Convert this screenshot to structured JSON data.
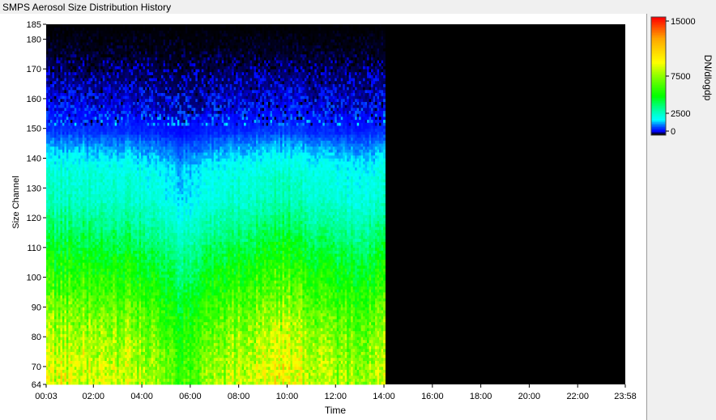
{
  "window": {
    "title": "SMPS Aerosol Size Distribution History"
  },
  "chart_data": {
    "type": "heatmap",
    "title": "SMPS Aerosol Size Distribution History",
    "xlabel": "Time",
    "ylabel": "Size Channel",
    "x_ticks": [
      "00:03",
      "02:00",
      "04:00",
      "06:00",
      "08:00",
      "10:00",
      "12:00",
      "14:00",
      "16:00",
      "18:00",
      "20:00",
      "22:00",
      "23:58"
    ],
    "y_ticks": [
      64,
      70,
      80,
      90,
      100,
      110,
      120,
      130,
      140,
      150,
      160,
      170,
      180,
      185
    ],
    "ylim": [
      64,
      185
    ],
    "data_range": [
      "00:03",
      "14:00"
    ],
    "colorbar": {
      "label": "DN/dlogdp",
      "ticks": [
        "15000",
        "7500",
        "2500",
        "0"
      ],
      "min": 0,
      "max": 15000,
      "colors": [
        "#000000",
        "#0000ff",
        "#00ffff",
        "#00ff00",
        "#ffff00",
        "#ffa500",
        "#ff0000"
      ]
    },
    "profile_by_channel": [
      {
        "channel": 66,
        "level": 6500
      },
      {
        "channel": 75,
        "level": 6000
      },
      {
        "channel": 85,
        "level": 5000
      },
      {
        "channel": 95,
        "level": 3800
      },
      {
        "channel": 105,
        "level": 2800
      },
      {
        "channel": 115,
        "level": 1800
      },
      {
        "channel": 125,
        "level": 1100
      },
      {
        "channel": 135,
        "level": 900
      },
      {
        "channel": 142,
        "level": 500
      },
      {
        "channel": 148,
        "level": 200
      },
      {
        "channel": 155,
        "level": 80
      },
      {
        "channel": 165,
        "level": 40
      },
      {
        "channel": 175,
        "level": 10
      },
      {
        "channel": 185,
        "level": 0
      }
    ],
    "profile_by_time": [
      {
        "time": "00:03",
        "level": 1.0
      },
      {
        "time": "02:00",
        "level": 1.0
      },
      {
        "time": "04:00",
        "level": 0.9
      },
      {
        "time": "05:30",
        "level": 0.55
      },
      {
        "time": "06:00",
        "level": 0.6
      },
      {
        "time": "08:00",
        "level": 0.95
      },
      {
        "time": "10:00",
        "level": 1.2
      },
      {
        "time": "11:00",
        "level": 0.95
      },
      {
        "time": "12:00",
        "level": 0.8
      },
      {
        "time": "13:30",
        "level": 0.85
      },
      {
        "time": "14:00",
        "level": 1.1
      }
    ]
  }
}
